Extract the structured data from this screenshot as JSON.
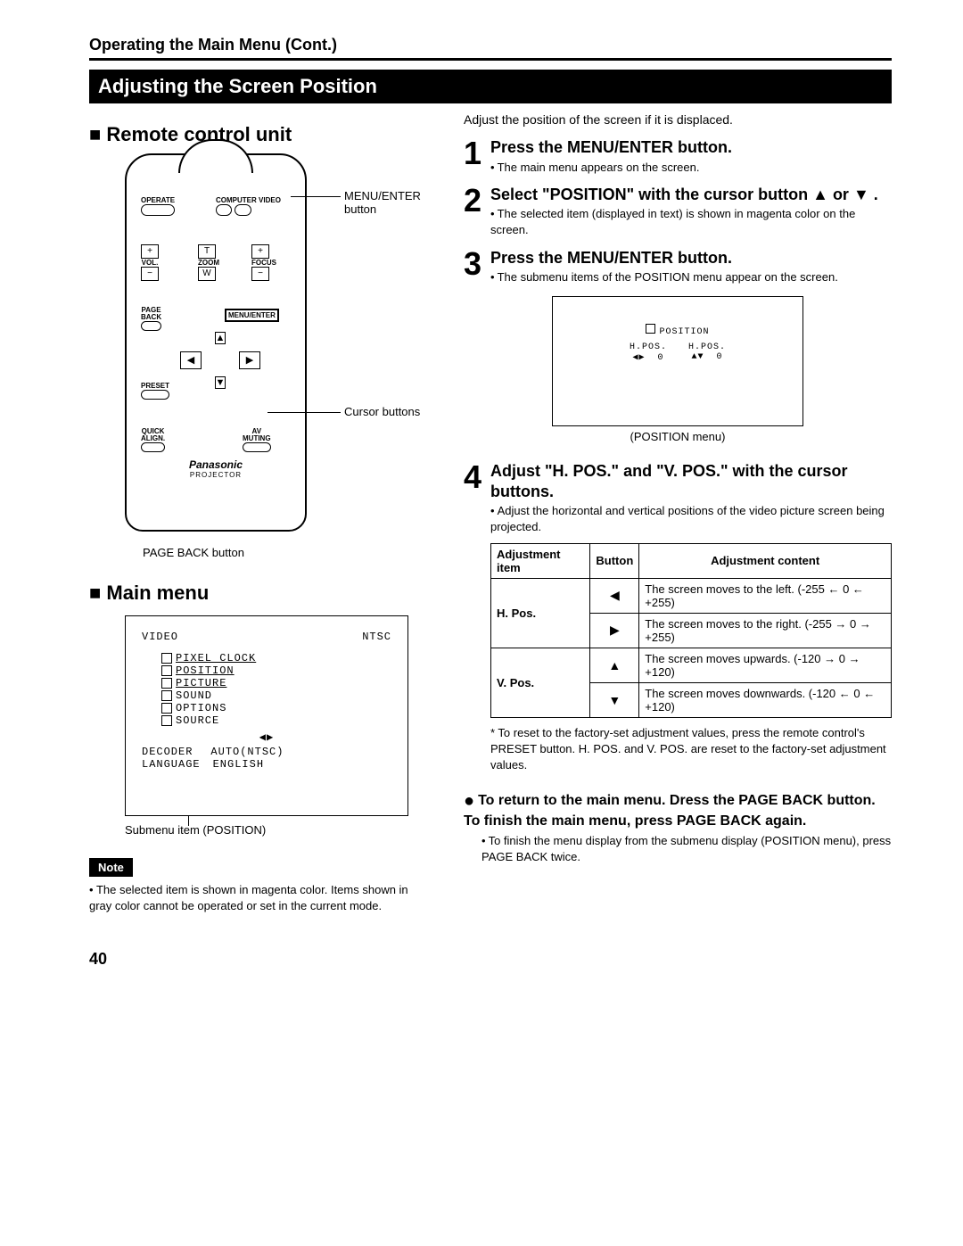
{
  "breadcrumb": "Operating the Main Menu (Cont.)",
  "title": "Adjusting the Screen Position",
  "left": {
    "remote_heading": "■ Remote control unit",
    "callouts": {
      "menu_enter": "MENU/ENTER button",
      "cursor": "Cursor buttons",
      "page_back": "PAGE BACK button"
    },
    "remote": {
      "operate": "OPERATE",
      "computer": "COMPUTER",
      "video": "VIDEO",
      "vol": "VOL.",
      "zoom": "ZOOM",
      "zoom_t": "T",
      "zoom_w": "W",
      "focus": "FOCUS",
      "plus": "+",
      "minus": "−",
      "page_back": "PAGE BACK",
      "menu_enter": "MENU/ENTER",
      "preset": "PRESET",
      "quick_align": "QUICK ALIGN.",
      "av_muting": "AV MUTING",
      "brand": "Panasonic",
      "projector": "PROJECTOR"
    },
    "main_menu_heading": "■ Main menu",
    "menu_box": {
      "video": "VIDEO",
      "ntsc": "NTSC",
      "items": [
        "PIXEL CLOCK",
        "POSITION",
        "PICTURE",
        "SOUND",
        "OPTIONS",
        "SOURCE"
      ],
      "arrows": "◀▶",
      "decoder": "DECODER",
      "decoder_val": "AUTO(NTSC)",
      "language": "LANGUAGE",
      "language_val": "ENGLISH"
    },
    "submenu_caption": "Submenu item (POSITION)",
    "note_label": "Note",
    "note_text": "The selected item is shown in magenta color. Items shown in gray color cannot be operated or set in the current mode."
  },
  "right": {
    "intro": "Adjust the position of the screen if it is displaced.",
    "steps": {
      "s1_title": "Press the MENU/ENTER button.",
      "s1_bullet": "The main menu appears on the screen.",
      "s2_title_a": "Select \"POSITION\" with the cursor button",
      "s2_title_b": "▲ or ▼ .",
      "s2_bullet": "The selected item (displayed in text) is shown in magenta color on the screen.",
      "s3_title": "Press the MENU/ENTER button.",
      "s3_bullet": "The submenu items of the POSITION menu appear on the screen.",
      "s4_title": "Adjust \"H. POS.\" and \"V. POS.\" with the cursor buttons.",
      "s4_bullet": "Adjust the horizontal and vertical positions of the video picture screen being projected."
    },
    "pos_menu": {
      "title": "POSITION",
      "h_label": "H.POS.",
      "h_arrows": "◀▶",
      "h_val": "0",
      "v_label_placeholder": "H.POS.",
      "v_arrows": "▲▼",
      "v_val": "0",
      "caption": "(POSITION menu)"
    },
    "table": {
      "h_item": "Adjustment item",
      "h_btn": "Button",
      "h_content": "Adjustment content",
      "hpos": "H. Pos.",
      "vpos": "V. Pos.",
      "left_btn": "◀",
      "right_btn": "▶",
      "up_btn": "▲",
      "down_btn": "▼",
      "r1": "The screen moves to the left. (-255 ← 0 ← +255)",
      "r2": "The screen moves to the right. (-255 → 0 → +255)",
      "r3": "The screen moves upwards. (-120 → 0 → +120)",
      "r4": "The screen moves downwards. (-120 ← 0 ← +120)"
    },
    "footnote": "* To reset to the factory-set adjustment values, press the remote control's PRESET button. H. POS. and V. POS. are reset to the factory-set adjustment values.",
    "return_title": "To return to the main menu. Dress the PAGE BACK button. To finish the main menu, press PAGE BACK again.",
    "return_bullet": "To finish the menu display from the submenu display (POSITION menu), press PAGE BACK twice."
  },
  "page_number": "40"
}
